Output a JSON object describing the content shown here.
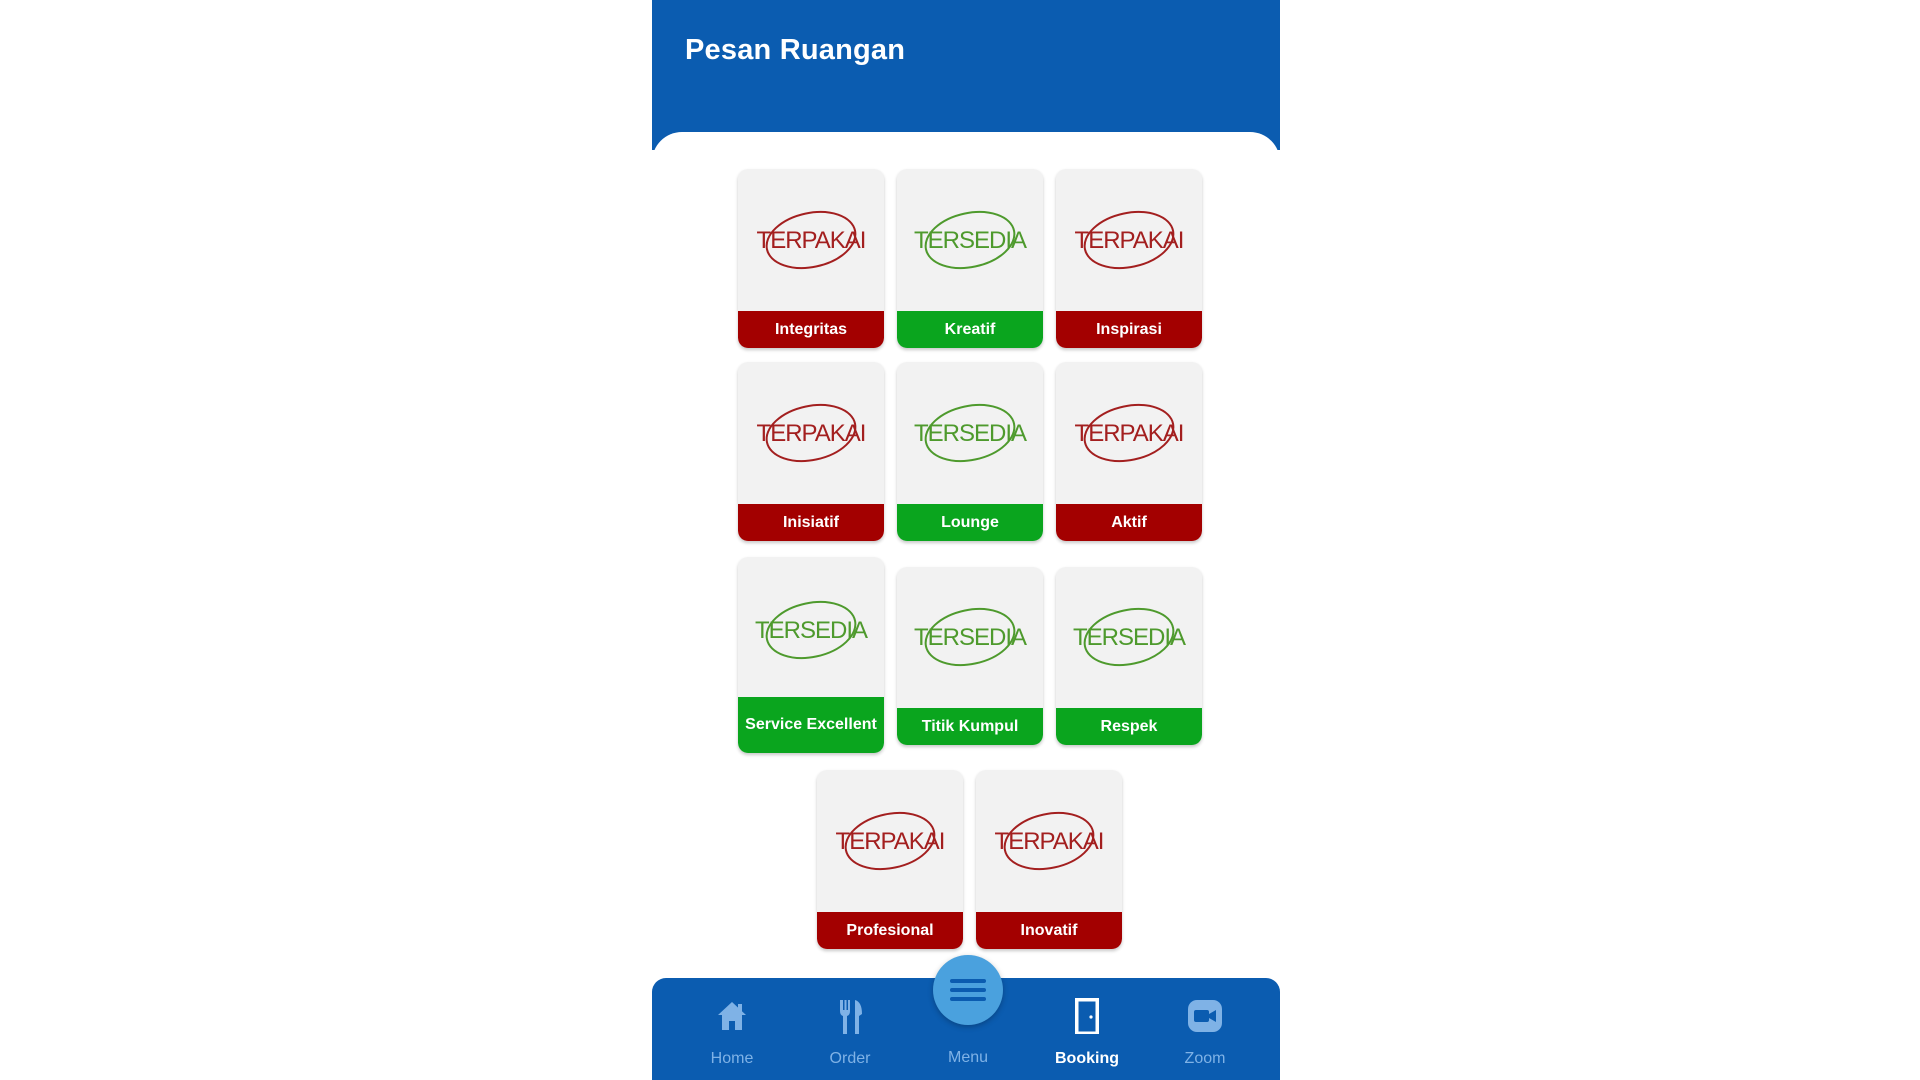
{
  "header": {
    "title": "Pesan Ruangan"
  },
  "status_text": {
    "used": "TERPAKAI",
    "available": "TERSEDIA"
  },
  "colors": {
    "primary": "#0b5cb0",
    "used": "#a30000",
    "available": "#0aa51e",
    "used_logo": "#a31f1f",
    "available_logo": "#4e9a2d"
  },
  "rooms": [
    {
      "name": "Integritas",
      "status": "used"
    },
    {
      "name": "Kreatif",
      "status": "available"
    },
    {
      "name": "Inspirasi",
      "status": "used"
    },
    {
      "name": "Inisiatif",
      "status": "used"
    },
    {
      "name": "Lounge",
      "status": "available"
    },
    {
      "name": "Aktif",
      "status": "used"
    },
    {
      "name": "Service Excellent",
      "status": "available"
    },
    {
      "name": "Titik Kumpul",
      "status": "available"
    },
    {
      "name": "Respek",
      "status": "available"
    },
    {
      "name": "Profesional",
      "status": "used"
    },
    {
      "name": "Inovatif",
      "status": "used"
    }
  ],
  "bottom_nav": {
    "items": [
      {
        "label": "Home",
        "icon": "home-icon"
      },
      {
        "label": "Order",
        "icon": "fork-knife-icon"
      },
      {
        "label": "Menu",
        "icon": "hamburger-menu-icon"
      },
      {
        "label": "Booking",
        "icon": "door-icon",
        "active": true
      },
      {
        "label": "Zoom",
        "icon": "video-camera-icon"
      }
    ]
  }
}
